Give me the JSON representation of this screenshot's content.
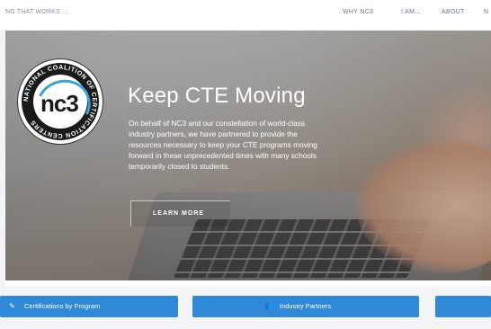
{
  "header": {
    "tagline": "NG THAT WORKS ...",
    "nav": [
      "WHY NC3",
      "I AM...",
      "ABOUT",
      "N"
    ]
  },
  "hero": {
    "logo_text": "nc3",
    "logo_ring_text": "NATIONAL COALITION OF CERTIFICATION CENTERS",
    "title": "Keep CTE Moving",
    "body": [
      "On behalf of NC3 and our constellation of world-class",
      "industry partners, we have partnered to provide the",
      "resources necessary to keep your CTE programs moving",
      "forward in these unprecedented times with many schools",
      "temporarily closed to students."
    ],
    "cta": "LEARN MORE"
  },
  "buttons": [
    {
      "label": "Certifications by Program",
      "icon": "pencil-icon"
    },
    {
      "label": "Industry Partners",
      "icon": "users-icon"
    },
    {
      "label": "",
      "icon": ""
    }
  ],
  "colors": {
    "accent": "#2f89d8",
    "logo_blue": "#3aa3d8"
  }
}
